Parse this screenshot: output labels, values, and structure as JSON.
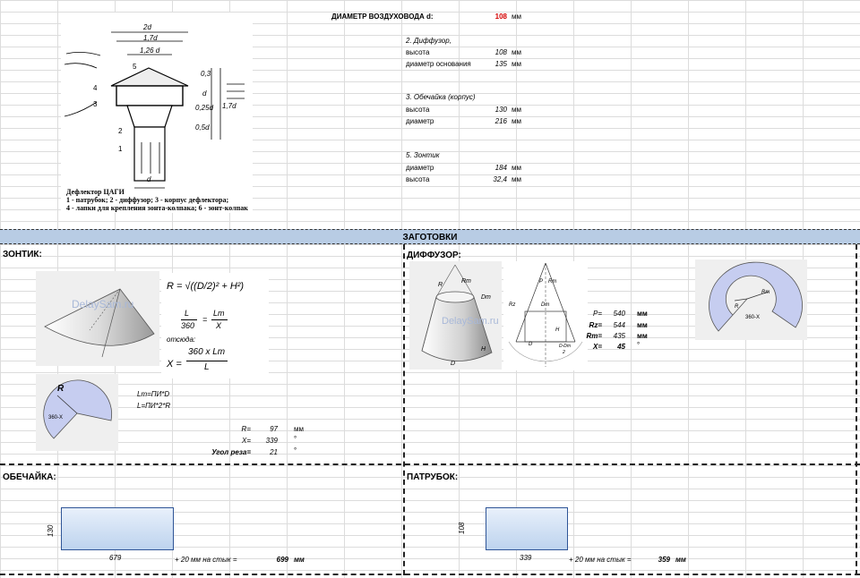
{
  "top": {
    "duct_label": "ДИАМЕТР ВОЗДУХОВОДА d:",
    "duct_value": "108",
    "duct_unit": "мм",
    "diffuser_header": "2. Диффузор,",
    "diffuser_height_label": "высота",
    "diffuser_height_value": "108",
    "diffuser_height_unit": "мм",
    "diffuser_base_label": "диаметр основания",
    "diffuser_base_value": "135",
    "diffuser_base_unit": "мм",
    "shell_header": "3. Обечайка (корпус)",
    "shell_height_label": "высота",
    "shell_height_value": "130",
    "shell_height_unit": "мм",
    "shell_diameter_label": "диаметр",
    "shell_diameter_value": "216",
    "shell_diameter_unit": "мм",
    "umbrella_header": "5. Зонтик",
    "umbrella_diameter_label": "диаметр",
    "umbrella_diameter_value": "184",
    "umbrella_diameter_unit": "мм",
    "umbrella_height_label": "высота",
    "umbrella_height_value": "32,4",
    "umbrella_height_unit": "мм"
  },
  "drawing": {
    "dim_2d": "2d",
    "dim_17d": "1,7d",
    "dim_126d": "1,26 d",
    "dim_d": "d",
    "num_1": "1",
    "num_2": "2",
    "num_3": "3",
    "num_4": "4",
    "num_5": "5",
    "side_05d": "0,5d",
    "side_03d": "0,3",
    "side_025d": "0,25d",
    "side_d_right": "d",
    "side_17d": "1,7d",
    "caption_title": "Дефлектор ЦАГИ",
    "caption_line1": "1 - патрубок; 2 - диффузор; 3 - корпус дефлектора;",
    "caption_line2": "4 - лапки для крепления зонта-колпака; 6 - зонт-колпак"
  },
  "band_title": "ЗАГОТОВКИ",
  "umbrella": {
    "title": "ЗОНТИК:",
    "formula_R": "R = √((D/2)² + H²)",
    "formula_L": "L",
    "formula_360": "360",
    "formula_Lm": "Lm",
    "formula_X": "X",
    "formula_hence": "отсюда:",
    "formula_Xres": "X =",
    "formula_num": "360 x Lm",
    "formula_den": "L",
    "lm_formula": "Lm=ПИ*D",
    "l_formula": "L=ПИ*2*R",
    "r_label": "R=",
    "r_value": "97",
    "r_unit": "мм",
    "x_label": "X=",
    "x_value": "339",
    "x_unit": "°",
    "cut_label": "Угол реза=",
    "cut_value": "21",
    "cut_unit": "°",
    "pic_R": "R",
    "pic_360x": "360-X",
    "watermark": "DelaySam.ru"
  },
  "diffuser": {
    "title": "ДИФФУЗОР:",
    "p_label": "P=",
    "p_value": "540",
    "p_unit": "мм",
    "rz_label": "Rz=",
    "rz_value": "544",
    "rz_unit": "мм",
    "rm_label": "Rm=",
    "rm_value": "435",
    "rm_unit": "мм",
    "x_label": "X=",
    "x_value": "45",
    "x_unit": "°",
    "pic_R": "R",
    "pic_Rm": "Rm",
    "pic_Dm": "Dm",
    "pic_H": "H",
    "pic_D": "D",
    "pic_P": "P",
    "pic_Rz": "Rz",
    "pic_DDm": "D-Dm",
    "pic_2": "2",
    "pic_360x": "360-X",
    "watermark": "DelaySam.ru"
  },
  "shell": {
    "title": "ОБЕЧАЙКА:",
    "height": "130",
    "width": "679",
    "plus_label": "+ 20 мм на стык =",
    "total": "699",
    "unit": "мм"
  },
  "pipe": {
    "title": "ПАТРУБОК:",
    "height": "108",
    "width": "339",
    "plus_label": "+ 20 мм на стык =",
    "total": "359",
    "unit": "мм"
  }
}
